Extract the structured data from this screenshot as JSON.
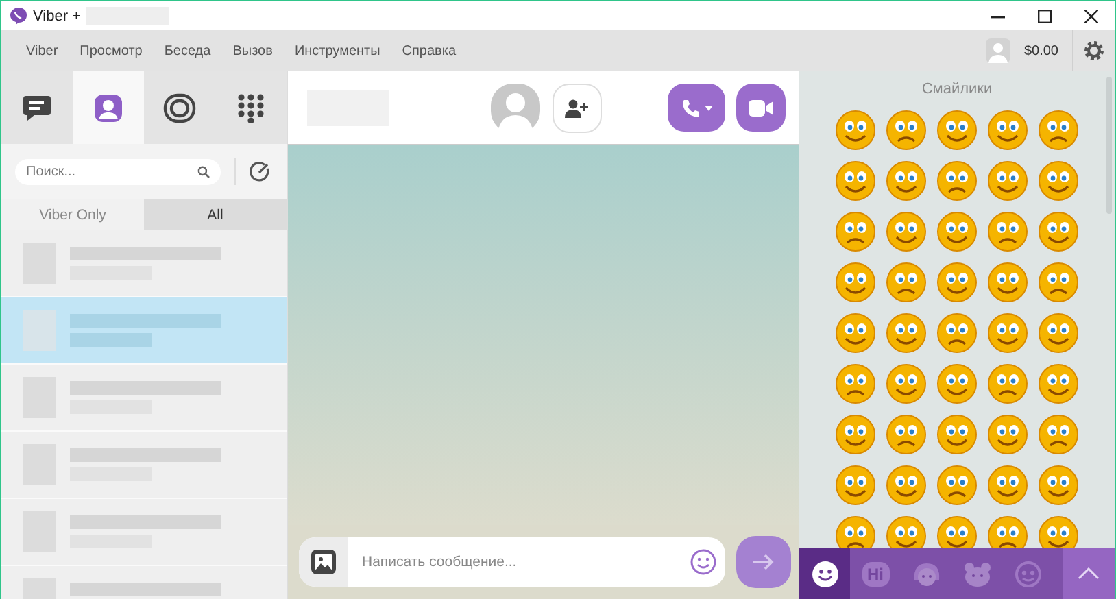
{
  "window": {
    "title": "Viber +"
  },
  "menu": [
    "Viber",
    "Просмотр",
    "Беседа",
    "Вызов",
    "Инструменты",
    "Справка"
  ],
  "account": {
    "balance": "$0.00"
  },
  "nav_tabs": [
    {
      "kind": "chats",
      "selected": false
    },
    {
      "kind": "contacts",
      "selected": true
    },
    {
      "kind": "public",
      "selected": false
    },
    {
      "kind": "dialpad",
      "selected": false
    }
  ],
  "search": {
    "placeholder": "Поиск..."
  },
  "filter_tabs": [
    {
      "label": "Viber Only",
      "selected": false
    },
    {
      "label": "All",
      "selected": true
    }
  ],
  "chats": [
    {
      "selected": false
    },
    {
      "selected": true
    },
    {
      "selected": false
    },
    {
      "selected": false
    },
    {
      "selected": false
    },
    {
      "selected": false
    }
  ],
  "composer": {
    "placeholder": "Написать сообщение..."
  },
  "stickers": {
    "title": "Смайлики",
    "tabs": [
      {
        "kind": "smiley",
        "selected": true
      },
      {
        "kind": "hi",
        "label": "Hi",
        "selected": false
      },
      {
        "kind": "girl",
        "selected": false
      },
      {
        "kind": "bear",
        "selected": false
      },
      {
        "kind": "face",
        "selected": false
      }
    ]
  }
}
